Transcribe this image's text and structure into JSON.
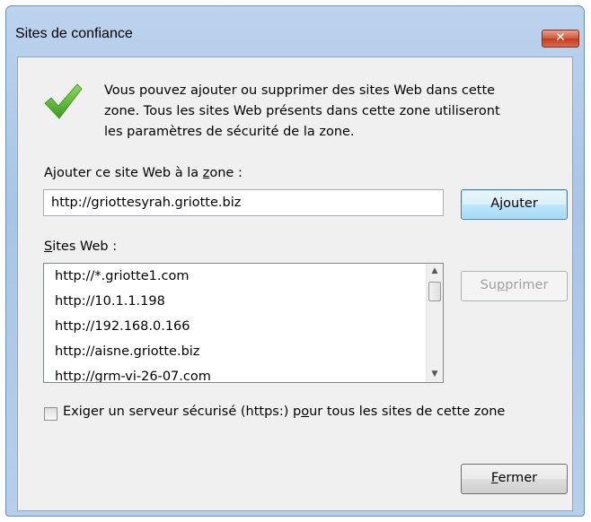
{
  "dialog": {
    "title": "Sites de confiance",
    "close_glyph": "✕",
    "accent_colors": {
      "close_button": "#c7452a",
      "default_button_border": "#3c7fb1",
      "check_icon": "#5cb531"
    }
  },
  "description": {
    "icon": "green-checkmark-icon",
    "lines": [
      "Vous pouvez ajouter ou supprimer des sites Web dans cette",
      "zone. Tous les sites Web présents dans cette zone utiliseront",
      "les paramètres de sécurité de la zone."
    ]
  },
  "add_site": {
    "label_before": "Ajouter ce site Web à la ",
    "label_accel": "z",
    "label_after": "one :",
    "input_value": "http://griottesyrah.griotte.biz",
    "button_label": "Ajouter"
  },
  "sites_list": {
    "label_accel": "S",
    "label_after": "ites Web :",
    "items": [
      "http://*.griotte1.com",
      "http://10.1.1.198",
      "http://192.168.0.166",
      "http://aisne.griotte.biz",
      "http://grm-vi-26-07.com"
    ],
    "remove_before": "Su",
    "remove_accel": "p",
    "remove_after": "primer"
  },
  "https_option": {
    "checked": false,
    "label_before": "Exiger un serveur sécurisé (https:) p",
    "label_accel": "o",
    "label_after": "ur tous les sites de cette zone"
  },
  "footer": {
    "close_accel": "F",
    "close_after": "ermer"
  }
}
